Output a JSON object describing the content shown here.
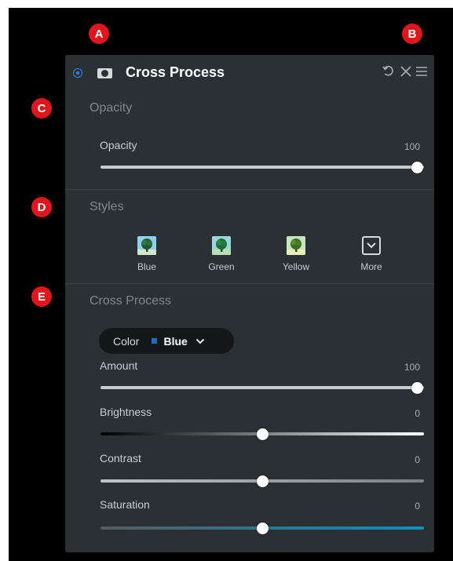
{
  "markers": [
    "A",
    "B",
    "C",
    "D",
    "E"
  ],
  "header": {
    "title": "Cross Process",
    "icons": [
      "enable-toggle-icon",
      "mask-icon",
      "reset-icon",
      "close-icon",
      "menu-icon"
    ]
  },
  "opacity_section": {
    "title": "Opacity",
    "slider": {
      "label": "Opacity",
      "value": "100",
      "level": 1.0
    }
  },
  "styles_section": {
    "title": "Styles",
    "presets": [
      "Blue",
      "Green",
      "Yellow"
    ],
    "more_label": "More"
  },
  "cross_process_section": {
    "title": "Cross Process",
    "color_dropdown": {
      "label": "Color",
      "value": "Blue",
      "swatch_color": "#1a6fc4"
    },
    "sliders": [
      {
        "label": "Amount",
        "value": "100",
        "level": 1.0
      },
      {
        "label": "Brightness",
        "value": "0",
        "level": 0.5
      },
      {
        "label": "Contrast",
        "value": "0",
        "level": 0.5
      },
      {
        "label": "Saturation",
        "value": "0",
        "level": 0.5
      }
    ]
  },
  "colors": {
    "accent": "#2a8bf2",
    "marker": "#e0161c",
    "panel_bg": "#2b3034",
    "saturation_track": "#0e8fbf"
  }
}
